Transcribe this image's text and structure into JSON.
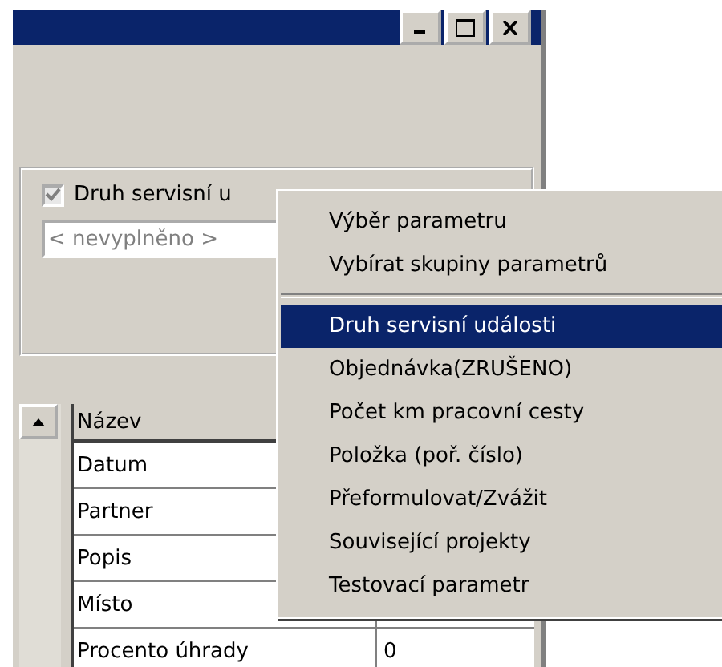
{
  "parameter": {
    "checkbox": {
      "label": "Druh servisní u",
      "checked": true
    },
    "field": {
      "placeholder": "< nevyplněno >"
    }
  },
  "table": {
    "columns": [
      "Název"
    ],
    "rows": [
      {
        "name": "Datum"
      },
      {
        "name": "Partner"
      },
      {
        "name": "Popis"
      },
      {
        "name": "Místo"
      },
      {
        "name": "Procento úhrady",
        "value": "0"
      }
    ]
  },
  "context_menu": {
    "items": [
      {
        "kind": "item",
        "label": "Výběr parametru",
        "selected": false
      },
      {
        "kind": "item",
        "label": "Vybírat skupiny parametrů",
        "selected": false
      },
      {
        "kind": "separator"
      },
      {
        "kind": "item",
        "label": "Druh servisní události",
        "selected": true
      },
      {
        "kind": "item",
        "label": "Objednávka(ZRUŠENO)",
        "selected": false
      },
      {
        "kind": "item",
        "label": "Počet km pracovní cesty",
        "selected": false
      },
      {
        "kind": "item",
        "label": "Položka (poř. číslo)",
        "selected": false
      },
      {
        "kind": "item",
        "label": "Přeformulovat/Zvážit",
        "selected": false
      },
      {
        "kind": "item",
        "label": "Související projekty",
        "selected": false
      },
      {
        "kind": "item",
        "label": "Testovací parametr",
        "selected": false
      }
    ]
  }
}
